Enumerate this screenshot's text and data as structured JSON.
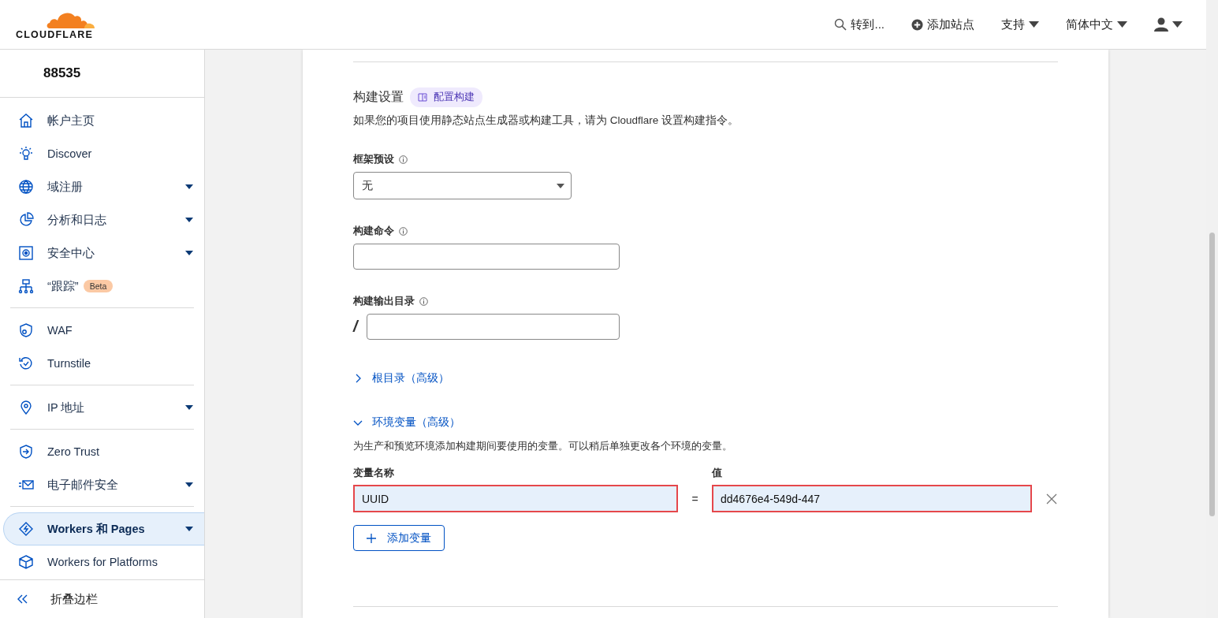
{
  "header": {
    "logo_text": "CLOUDFLARE",
    "search_label": "转到...",
    "add_site": "添加站点",
    "menus": [
      {
        "label": "支持"
      },
      {
        "label": "简体中文"
      }
    ]
  },
  "sidebar": {
    "account": "88535",
    "groups": [
      [
        {
          "label": "帐户主页",
          "has_menu": false,
          "selected": false
        },
        {
          "label": "Discover",
          "has_menu": false,
          "selected": false
        },
        {
          "label": "域注册",
          "has_menu": true,
          "selected": false
        },
        {
          "label": "分析和日志",
          "has_menu": true,
          "selected": false
        },
        {
          "label": "安全中心",
          "has_menu": true,
          "selected": false
        },
        {
          "label": "“跟踪”",
          "badge": "Beta",
          "has_menu": false,
          "selected": false
        }
      ],
      [
        {
          "label": "WAF",
          "has_menu": false,
          "selected": false
        },
        {
          "label": "Turnstile",
          "has_menu": false,
          "selected": false
        }
      ],
      [
        {
          "label": "IP 地址",
          "has_menu": true,
          "selected": false
        }
      ],
      [
        {
          "label": "Zero Trust",
          "has_menu": false,
          "selected": false
        },
        {
          "label": "电子邮件安全",
          "has_menu": true,
          "selected": false
        }
      ],
      [
        {
          "label": "Workers 和 Pages",
          "has_menu": true,
          "selected": true
        },
        {
          "label": "Workers for Platforms",
          "has_menu": false,
          "selected": false
        }
      ]
    ],
    "collapse": "折叠边栏"
  },
  "build": {
    "title": "构建设置",
    "badge": "配置构建",
    "description": "如果您的项目使用静态站点生成器或构建工具，请为 Cloudflare 设置构建指令。",
    "fields": [
      {
        "kind": "select",
        "label": "框架预设",
        "value": "无"
      },
      {
        "kind": "input",
        "label": "构建命令"
      },
      {
        "kind": "prefixed",
        "label": "构建输出目录",
        "prefix": "/"
      }
    ],
    "sections": [
      {
        "label": "根目录（高级）",
        "expanded": false
      },
      {
        "label": "环境变量（高级）",
        "expanded": true
      }
    ],
    "env": {
      "description": "为生产和预览环境添加构建期间要使用的变量。可以稍后单独更改各个环境的变量。",
      "name_header": "变量名称",
      "value_header": "值",
      "equals": "=",
      "rows": [
        {
          "name": "UUID",
          "value": "dd4676e4-549d-447",
          "highlighted": true
        }
      ],
      "add_button": "添加变量"
    }
  }
}
